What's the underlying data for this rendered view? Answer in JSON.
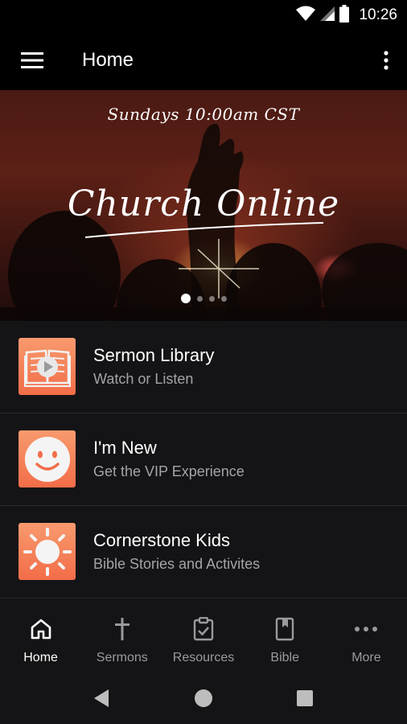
{
  "status_bar": {
    "time": "10:26",
    "icons": [
      "wifi-icon",
      "signal-icon",
      "battery-icon"
    ]
  },
  "app_bar": {
    "title": "Home",
    "icons": [
      "menu-icon",
      "overflow-menu-icon"
    ]
  },
  "hero": {
    "subtitle": "Sundays 10:00am CST",
    "title": "Church Online",
    "carousel": {
      "total": 4,
      "active_index": 0
    }
  },
  "list": {
    "items": [
      {
        "title": "Sermon Library",
        "subtitle": "Watch or Listen",
        "icon": "book-play-icon"
      },
      {
        "title": "I'm New",
        "subtitle": "Get the VIP Experience",
        "icon": "smiley-icon"
      },
      {
        "title": "Cornerstone Kids",
        "subtitle": "Bible Stories and Activites",
        "icon": "sun-icon"
      }
    ]
  },
  "bottom_nav": {
    "items": [
      {
        "label": "Home",
        "icon": "home-icon",
        "active": true
      },
      {
        "label": "Sermons",
        "icon": "cross-icon",
        "active": false
      },
      {
        "label": "Resources",
        "icon": "clipboard-check-icon",
        "active": false
      },
      {
        "label": "Bible",
        "icon": "bible-icon",
        "active": false
      },
      {
        "label": "More",
        "icon": "more-dots-icon",
        "active": false
      }
    ]
  },
  "system_nav": {
    "icons": [
      "back-icon",
      "home-circle-icon",
      "recents-icon"
    ]
  },
  "colors": {
    "background": "#141416",
    "bar": "#000000",
    "accent_gradient_top": "#f89a6e",
    "accent_gradient_bottom": "#f26d48",
    "muted_text": "#a4a4a8"
  }
}
